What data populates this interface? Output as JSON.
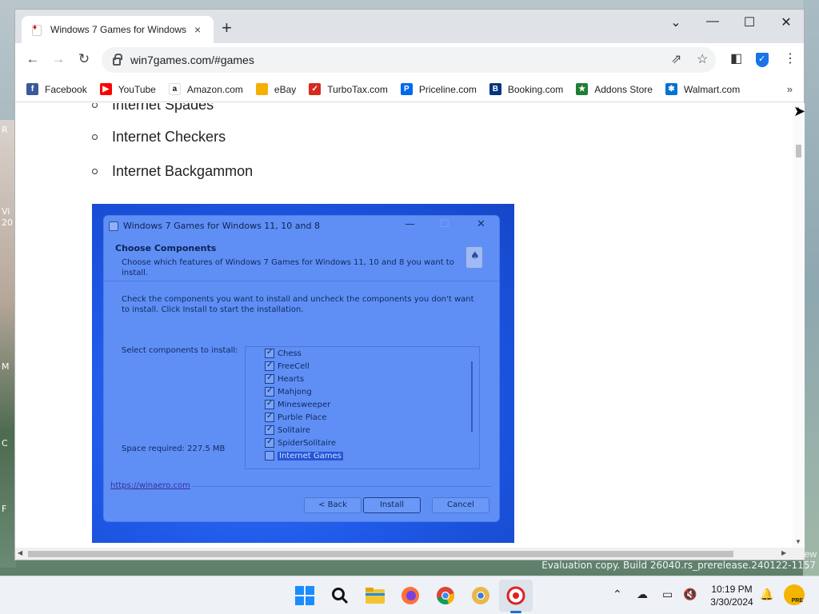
{
  "desktop": {
    "left_labels": [
      "R",
      "Vi",
      "20",
      "M",
      "C",
      "F"
    ],
    "right_label": "ew",
    "watermark": "Evaluation copy. Build 26040.rs_prerelease.240122-1157"
  },
  "browser": {
    "tab": {
      "title": "Windows 7 Games for Windows",
      "close": "×"
    },
    "new_tab": "+",
    "window_controls": {
      "dropdown": "⌄",
      "minimize": "—",
      "maximize": "☐",
      "close": "✕"
    },
    "toolbar": {
      "back": "←",
      "forward": "→",
      "reload": "↻",
      "url": "win7games.com/#games",
      "share": "⇗",
      "star": "☆",
      "sidepanel": "◧",
      "menu": "⋮"
    },
    "bookmarks": [
      {
        "label": "Facebook",
        "icon": "facebook-icon",
        "color": "#3b5998",
        "glyph": "f"
      },
      {
        "label": "YouTube",
        "icon": "youtube-icon",
        "color": "#ff0000",
        "glyph": "▶"
      },
      {
        "label": "Amazon.com",
        "icon": "amazon-icon",
        "color": "#ffffff",
        "glyph": "a"
      },
      {
        "label": "eBay",
        "icon": "ebay-icon",
        "color": "#f5af02",
        "glyph": ""
      },
      {
        "label": "TurboTax.com",
        "icon": "turbotax-icon",
        "color": "#d52b1e",
        "glyph": "✓"
      },
      {
        "label": "Priceline.com",
        "icon": "priceline-icon",
        "color": "#0068ef",
        "glyph": "P"
      },
      {
        "label": "Booking.com",
        "icon": "booking-icon",
        "color": "#003580",
        "glyph": "B"
      },
      {
        "label": "Addons Store",
        "icon": "addons-store-icon",
        "color": "#1e7e34",
        "glyph": "★"
      },
      {
        "label": "Walmart.com",
        "icon": "walmart-icon",
        "color": "#0071ce",
        "glyph": "✱"
      }
    ],
    "bookmarks_more": "»"
  },
  "page": {
    "games": [
      "Internet Spades",
      "Internet Checkers",
      "Internet Backgammon"
    ]
  },
  "installer": {
    "title": "Windows 7 Games for Windows 11, 10 and 8",
    "minimize": "—",
    "maximize": "☐",
    "close": "✕",
    "header_title": "Choose Components",
    "header_subtitle": "Choose which features of Windows 7 Games for Windows 11, 10 and 8 you want to install.",
    "description": "Check the components you want to install and uncheck the components you don't want to install. Click Install to start the installation.",
    "select_label": "Select components to install:",
    "space_required": "Space required: 227.5 MB",
    "components": [
      {
        "label": "Chess",
        "checked": true
      },
      {
        "label": "FreeCell",
        "checked": true
      },
      {
        "label": "Hearts",
        "checked": true
      },
      {
        "label": "Mahjong",
        "checked": true
      },
      {
        "label": "Minesweeper",
        "checked": true
      },
      {
        "label": "Purble Place",
        "checked": true
      },
      {
        "label": "Solitaire",
        "checked": true
      },
      {
        "label": "SpiderSolitaire",
        "checked": true
      },
      {
        "label": "Internet Games",
        "checked": false
      }
    ],
    "link": "https://winaero.com",
    "buttons": {
      "back": "< Back",
      "install": "Install",
      "cancel": "Cancel"
    }
  },
  "taskbar": {
    "clock_time": "10:19 PM",
    "clock_date": "3/30/2024",
    "pre_badge": "PRE",
    "accent": "#1a8cff"
  }
}
